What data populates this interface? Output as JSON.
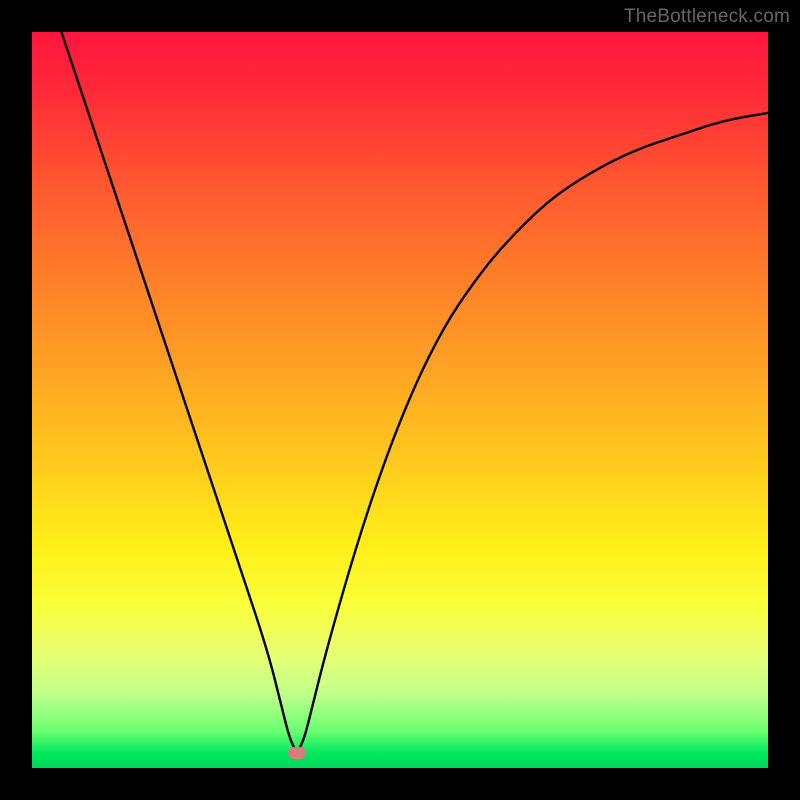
{
  "watermark": "TheBottleneck.com",
  "chart_data": {
    "type": "line",
    "title": "",
    "xlabel": "",
    "ylabel": "",
    "xlim": [
      0,
      100
    ],
    "ylim": [
      0,
      100
    ],
    "grid": false,
    "min_marker": {
      "x": 36,
      "y": 2
    },
    "series": [
      {
        "name": "curve",
        "x": [
          4,
          8,
          12,
          16,
          20,
          24,
          28,
          32,
          34,
          35,
          36,
          37,
          38,
          40,
          44,
          48,
          52,
          56,
          60,
          64,
          70,
          76,
          82,
          88,
          94,
          100
        ],
        "values": [
          100,
          88,
          76,
          64,
          52,
          40,
          28,
          16,
          8,
          4,
          2,
          4,
          8,
          16,
          30,
          42,
          52,
          60,
          66,
          71,
          77,
          81,
          84,
          86,
          88,
          89
        ]
      }
    ],
    "background_gradient": {
      "top": "#ff153e",
      "mid": "#fff018",
      "bottom": "#00d858"
    },
    "colors": {
      "curve": "#000000",
      "marker": "#d57d7b",
      "frame": "#000000"
    }
  }
}
